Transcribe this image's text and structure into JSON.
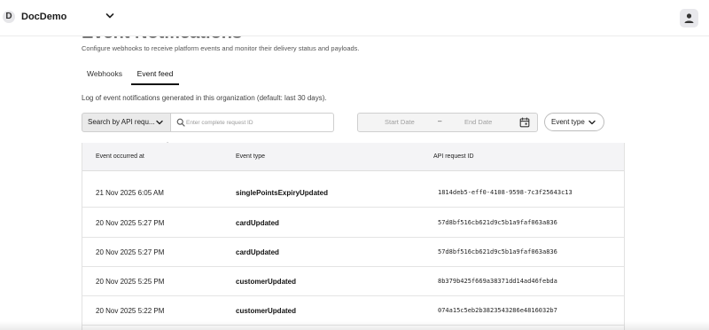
{
  "header": {
    "org_initial": "D",
    "org_name": "DocDemo"
  },
  "page": {
    "title": "Event Notifications",
    "description": "Configure webhooks to receive platform events and monitor their delivery status and payloads."
  },
  "tabs": [
    {
      "label": "Webhooks",
      "active": false
    },
    {
      "label": "Event feed",
      "active": true
    }
  ],
  "feed": {
    "description": "Log of event notifications generated in this organization (default: last 30 days)."
  },
  "filters": {
    "search_type": "Search by API requ...",
    "search_placeholder": "Enter complete request ID",
    "start_date_placeholder": "Start Date",
    "date_separator": "–",
    "end_date_placeholder": "End Date",
    "event_type_label": "Event type"
  },
  "table": {
    "columns": [
      "Event occurred at",
      "Event type",
      "API request ID"
    ],
    "rows": [
      {
        "occurred_at": "21 Nov 2025 6:05 AM",
        "event_type": "singlePointsExpiryUpdated",
        "request_id": "1814deb5-eff0-4108-9598-7c3f25643c13"
      },
      {
        "occurred_at": "20 Nov 2025 5:27 PM",
        "event_type": "cardUpdated",
        "request_id": "57d8bf516cb621d9c5b1a9faf063a836"
      },
      {
        "occurred_at": "20 Nov 2025 5:27 PM",
        "event_type": "cardUpdated",
        "request_id": "57d8bf516cb621d9c5b1a9faf063a836"
      },
      {
        "occurred_at": "20 Nov 2025 5:25 PM",
        "event_type": "customerUpdated",
        "request_id": "8b379b425f669a38371dd14ad46febda"
      },
      {
        "occurred_at": "20 Nov 2025 5:22 PM",
        "event_type": "customerUpdated",
        "request_id": "074a15c5eb2b3823543286e4816032b7"
      }
    ]
  },
  "icons": {
    "org_switcher": "chevron-down-icon",
    "account": "user-icon",
    "search": "search-icon",
    "calendar": "calendar-icon"
  }
}
